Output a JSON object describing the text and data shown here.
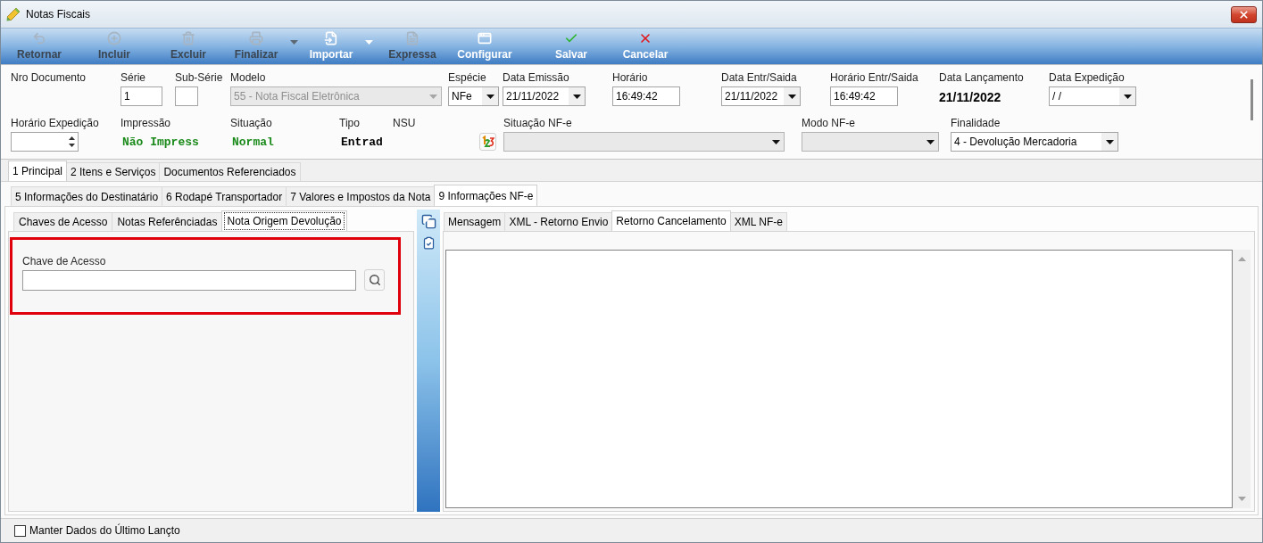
{
  "window": {
    "title": "Notas Fiscais"
  },
  "toolbar": [
    {
      "label": "Retornar",
      "disabled": true,
      "dropdown": false
    },
    {
      "label": "Incluir",
      "disabled": true,
      "dropdown": false
    },
    {
      "label": "Excluir",
      "disabled": true,
      "dropdown": false
    },
    {
      "label": "Finalizar",
      "disabled": true,
      "dropdown": true
    },
    {
      "label": "Importar",
      "disabled": false,
      "dropdown": true
    },
    {
      "label": "Expressa",
      "disabled": true,
      "dropdown": false
    },
    {
      "label": "Configurar",
      "disabled": false,
      "dropdown": false
    },
    {
      "label": "Salvar",
      "disabled": false,
      "dropdown": false
    },
    {
      "label": "Cancelar",
      "disabled": false,
      "dropdown": false
    }
  ],
  "header": {
    "row_1": [
      {
        "kind": "label",
        "label": "Nro Documento"
      },
      {
        "kind": "input",
        "label": "Série",
        "value": "1"
      },
      {
        "kind": "input",
        "label": "Sub-Série"
      },
      {
        "kind": "dropdown_list",
        "label": "Modelo",
        "value": "55 - Nota Fiscal Eletrônica",
        "disabled": true
      },
      {
        "kind": "dropdown",
        "label": "Espécie",
        "value": "NFe",
        "disabled": false
      },
      {
        "kind": "dropdown",
        "label": "Data Emissão",
        "value": "21/11/2022",
        "disabled": false
      },
      {
        "kind": "input",
        "label": "Horário",
        "value": "16:49:42"
      },
      {
        "kind": "dropdown",
        "label": "Data Entr/Saida",
        "value": "21/11/2022",
        "disabled": false
      },
      {
        "kind": "input",
        "label": "Horário Entr/Saida",
        "value": "16:49:42"
      },
      {
        "kind": "text",
        "label": "Data Lançamento",
        "value": "21/11/2022"
      },
      {
        "kind": "dropdown",
        "label": "Data Expedição",
        "value": "/ /",
        "disabled": false
      }
    ],
    "row_2": [
      {
        "kind": "spinner",
        "label": "Horário Expedição"
      },
      {
        "kind": "status",
        "label": "Impressão",
        "value": "Não Impress",
        "color": "#1a8a1a"
      },
      {
        "kind": "status",
        "label": "Situação",
        "value": "Normal",
        "color": "#1a8a1a"
      },
      {
        "kind": "status",
        "label": "Tipo",
        "value": "Entrad",
        "color": "#000000"
      },
      {
        "kind": "label",
        "label": "NSU"
      },
      {
        "kind": "icon_button"
      },
      {
        "kind": "dropdown_list",
        "label": "Situação NF-e",
        "disabled": false
      },
      {
        "kind": "dropdown_list",
        "label": "Modo NF-e",
        "disabled": false
      },
      {
        "kind": "dropdown",
        "label": "Finalidade",
        "value": "4 - Devolução Mercadoria",
        "disabled": false
      }
    ]
  },
  "tabs": [
    {
      "label": "1 Principal",
      "selected": true
    },
    {
      "label": "2 Itens e Serviços",
      "selected": false
    },
    {
      "label": "Documentos Referenciados",
      "selected": false
    }
  ],
  "sub_tabs": [
    {
      "label": "5 Informações do Destinatário",
      "selected": false
    },
    {
      "label": "6 Rodapé Transportador",
      "selected": false
    },
    {
      "label": "7 Valores e Impostos da Nota",
      "selected": false
    },
    {
      "label": "9 Informações NF-e",
      "selected": true
    }
  ],
  "nfe_panel": {
    "left_tabs": [
      {
        "label": "Chaves de Acesso",
        "selected": false,
        "focused": false
      },
      {
        "label": "Notas Referênciadas",
        "selected": false,
        "focused": false
      },
      {
        "label": "Nota Origem Devolução",
        "selected": true,
        "focused": true
      }
    ],
    "access_key": {
      "label": "Chave de Acesso",
      "highlighted": true
    },
    "right_tabs": [
      {
        "label": "Mensagem",
        "selected": false
      },
      {
        "label": "XML - Retorno Envio",
        "selected": false
      },
      {
        "label": "Retorno Cancelamento",
        "selected": true
      },
      {
        "label": "XML NF-e",
        "selected": false
      }
    ]
  },
  "footer": {
    "checkbox": {
      "label": "Manter Dados do Último Lançto",
      "checked": false
    }
  }
}
